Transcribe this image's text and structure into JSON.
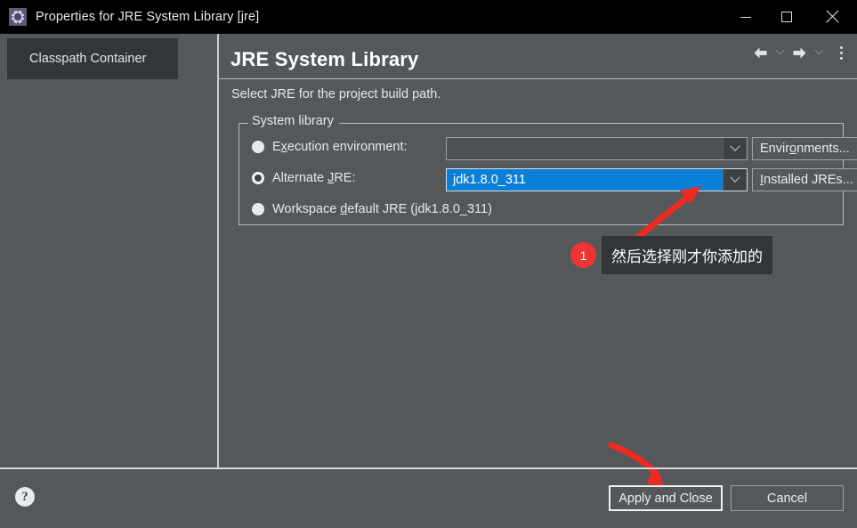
{
  "window": {
    "title": "Properties for JRE System Library [jre]",
    "icon": "gear-icon",
    "minimize_label": "–",
    "maximize_label": "□",
    "close_label": "✕"
  },
  "sidebar": {
    "items": [
      {
        "label": "Classpath Container",
        "selected": true
      }
    ]
  },
  "content": {
    "title": "JRE System Library",
    "subtitle": "Select JRE for the project build path.",
    "nav": {
      "back_icon": "arrow-left-icon",
      "back_menu_icon": "chevron-down-icon",
      "forward_icon": "arrow-right-icon",
      "forward_menu_icon": "chevron-down-icon",
      "overflow_icon": "vertical-dots-icon"
    },
    "group": {
      "legend": "System library",
      "rows": [
        {
          "id": "execution-environment",
          "label_pre": "E",
          "label_mnemonic": "x",
          "label_post": "ecution environment:",
          "selected": false,
          "combo_value": "",
          "button_pre": "Envir",
          "button_mnemonic": "o",
          "button_post": "nments..."
        },
        {
          "id": "alternate-jre",
          "label_pre": "Alternate ",
          "label_mnemonic": "J",
          "label_post": "RE:",
          "selected": true,
          "combo_value": "jdk1.8.0_311",
          "button_pre": "",
          "button_mnemonic": "I",
          "button_post": "nstalled JREs..."
        },
        {
          "id": "workspace-default-jre",
          "label_pre": "Workspace ",
          "label_mnemonic": "d",
          "label_post": "efault JRE (jdk1.8.0_311)",
          "selected": false
        }
      ]
    }
  },
  "annotation": {
    "badge": "1",
    "text": "然后选择刚才你添加的",
    "arrow_color": "#ee2b22",
    "badge_color": "#ee3434"
  },
  "footer": {
    "help_label": "?",
    "apply_label": "Apply and Close",
    "cancel_label": "Cancel"
  },
  "colors": {
    "background": "#54585a",
    "titlebar": "#000000",
    "selection_blue": "#0a7fd8",
    "tree_selected": "#333638",
    "border_light": "#b8bcbd"
  }
}
